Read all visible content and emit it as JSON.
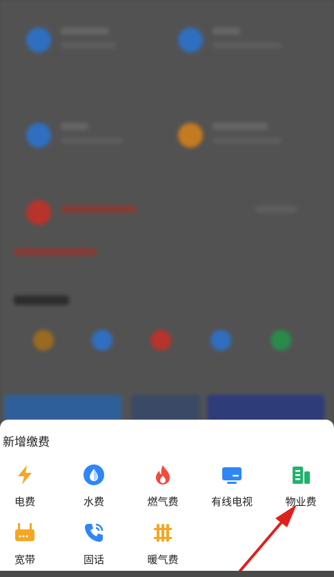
{
  "sheet": {
    "title": "新增缴费",
    "items": [
      {
        "label": "电费",
        "icon": "lightning-icon",
        "color": "#f5a623"
      },
      {
        "label": "水费",
        "icon": "water-drop-icon",
        "color": "#2f86f6"
      },
      {
        "label": "燃气费",
        "icon": "flame-icon",
        "color": "#f24b3d"
      },
      {
        "label": "有线电视",
        "icon": "tv-icon",
        "color": "#2f86f6"
      },
      {
        "label": "物业费",
        "icon": "building-icon",
        "color": "#1fb36b"
      },
      {
        "label": "宽带",
        "icon": "router-icon",
        "color": "#f5a623"
      },
      {
        "label": "固话",
        "icon": "phone-icon",
        "color": "#2f86f6"
      },
      {
        "label": "暖气费",
        "icon": "heater-icon",
        "color": "#f5a623"
      }
    ]
  },
  "colors": {
    "overlay": "#4a4a4a",
    "sheet_bg": "#ffffff",
    "annotation_arrow": "#e0201b"
  }
}
